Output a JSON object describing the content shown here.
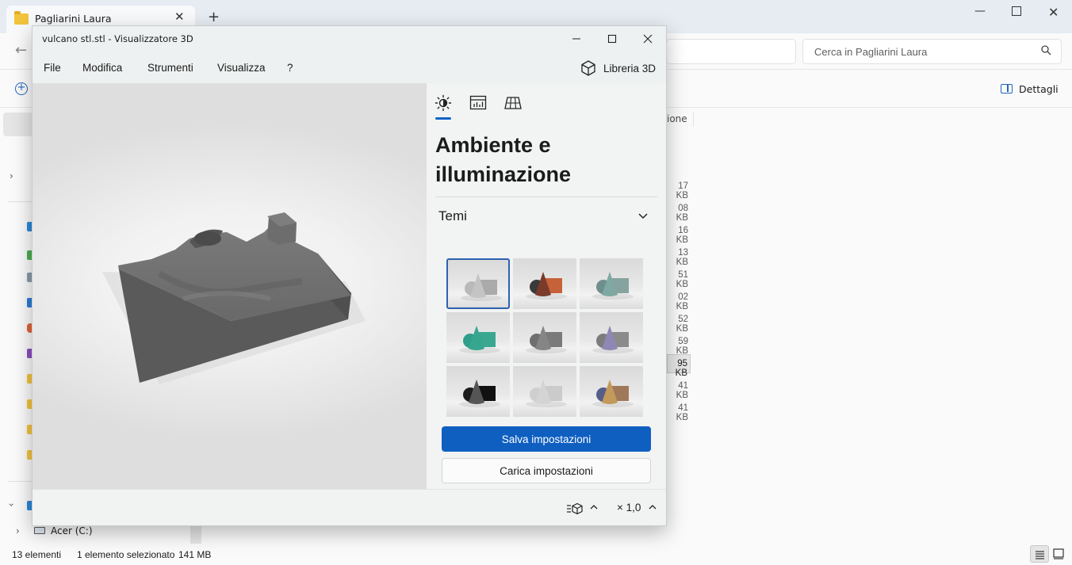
{
  "explorer": {
    "tab_title": "Pagliarini Laura",
    "search_placeholder": "Cerca in Pagliarini Laura",
    "details_label": "Dettagli",
    "column_partial": "ione",
    "sizes": [
      "17 KB",
      "08 KB",
      "16 KB",
      "13 KB",
      "51 KB",
      "02 KB",
      "52 KB",
      "59 KB",
      "95 KB",
      "41 KB",
      "41 KB"
    ],
    "drive_label": "Acer (C:)",
    "status_count": "13 elementi",
    "status_selected": "1 elemento selezionato",
    "status_size": "141 MB"
  },
  "viewer": {
    "title": "vulcano stl.stl - Visualizzatore 3D",
    "menu": [
      "File",
      "Modifica",
      "Strumenti",
      "Visualizza",
      "?"
    ],
    "library_label": "Libreria 3D",
    "panel": {
      "heading": "Ambiente e illuminazione",
      "section": "Temi",
      "save_button": "Salva impostazioni",
      "load_button": "Carica impostazioni",
      "themes": [
        {
          "sphere": "#b9b9b9",
          "cone": "#c4c4c4",
          "box": "#aaaaaa",
          "selected": true
        },
        {
          "sphere": "#3a3a3a",
          "cone": "#7a3a2c",
          "box": "#c5623a",
          "selected": false
        },
        {
          "sphere": "#6f8f8d",
          "cone": "#7fa8a2",
          "box": "#87a39f",
          "selected": false
        },
        {
          "sphere": "#2f9e8a",
          "cone": "#36a68f",
          "box": "#3aa891",
          "selected": false
        },
        {
          "sphere": "#6f6f6f",
          "cone": "#858585",
          "box": "#7a7a7a",
          "selected": false
        },
        {
          "sphere": "#7c7c7c",
          "cone": "#8f88b4",
          "box": "#8b8b8b",
          "selected": false
        },
        {
          "sphere": "#1d1d1d",
          "cone": "#555555",
          "box": "#111111",
          "selected": false
        },
        {
          "sphere": "#cfcfcf",
          "cone": "#d4d4d4",
          "box": "#cbcbcb",
          "selected": false
        },
        {
          "sphere": "#555d8a",
          "cone": "#c39a5a",
          "box": "#a0785a",
          "selected": false
        }
      ]
    },
    "zoom": "× 1,0"
  },
  "colors": {
    "accent": "#0f5fc1",
    "model": "#6e6e6e"
  }
}
